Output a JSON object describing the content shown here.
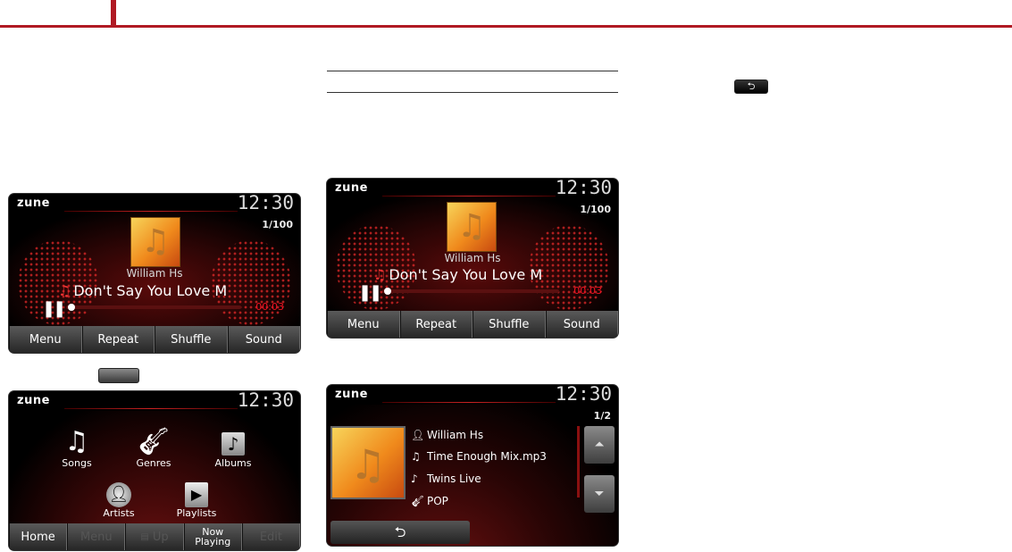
{
  "brand": "zune",
  "clock": "12:30",
  "now_playing": {
    "track_counter": "1/100",
    "artist": "William Hs",
    "song": "Don't Say You Love M",
    "elapsed": "00:03",
    "progress": 0.03,
    "buttons": [
      "Menu",
      "Repeat",
      "Shuffle",
      "Sound"
    ]
  },
  "menu_screen": {
    "items": [
      {
        "label": "Songs",
        "icon": "music-note-icon"
      },
      {
        "label": "Genres",
        "icon": "guitar-icon"
      },
      {
        "label": "Albums",
        "icon": "album-icon"
      },
      {
        "label": "Artists",
        "icon": "artist-icon"
      },
      {
        "label": "Playlists",
        "icon": "playlist-icon"
      }
    ],
    "buttons": [
      "Home",
      "Menu",
      "Up",
      "Now Playing",
      "Edit"
    ]
  },
  "info_screen": {
    "page": "1/2",
    "artist": "William Hs",
    "file": "Time Enough Mix.mp3",
    "album": "Twins Live",
    "genre": "POP",
    "back_symbol": "⮌"
  }
}
